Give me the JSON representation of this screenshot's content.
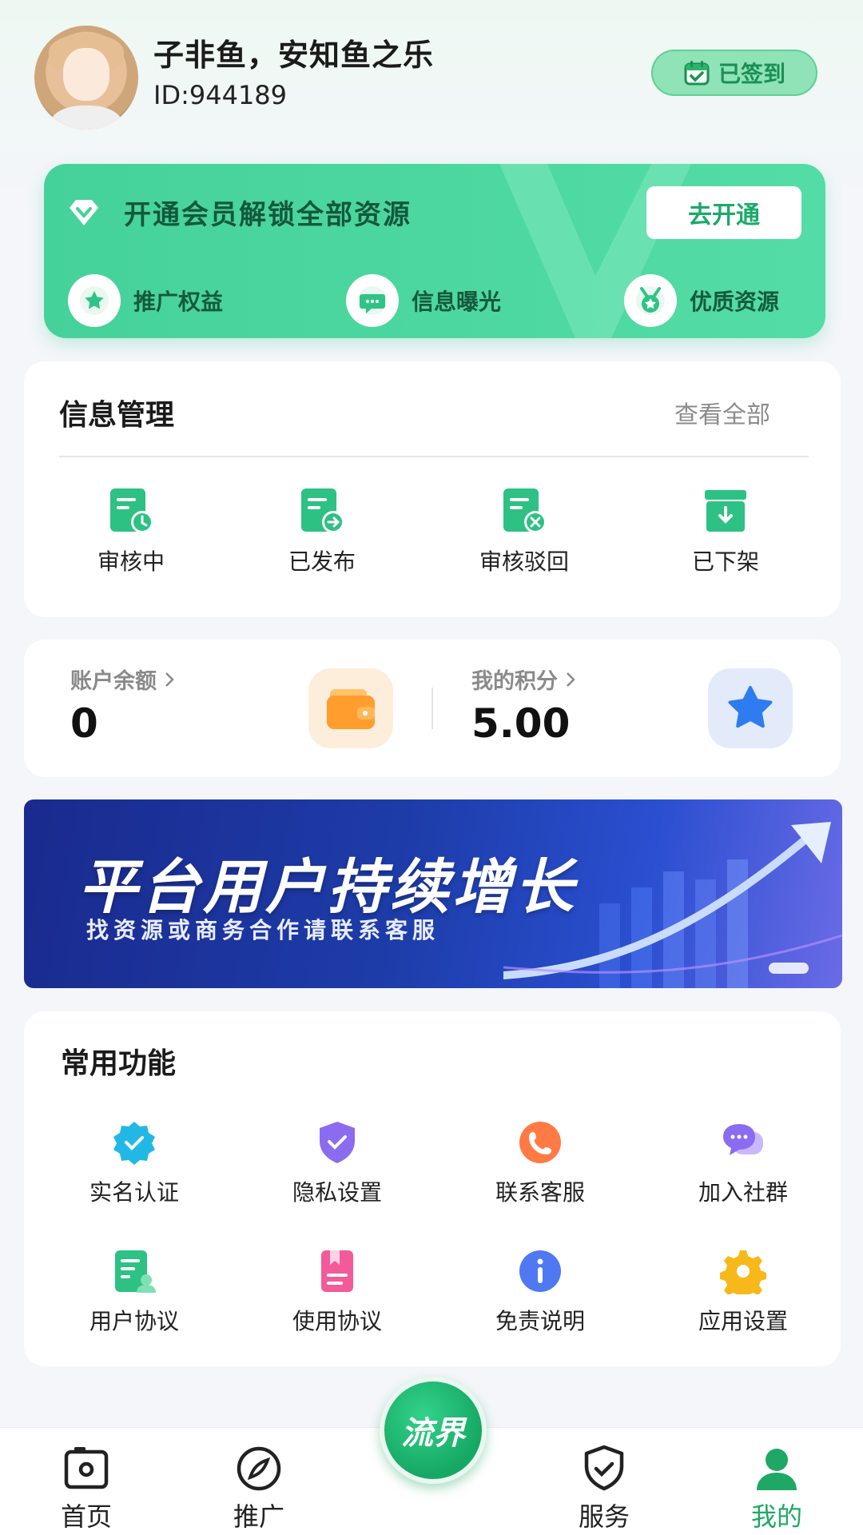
{
  "header": {
    "username": "子非鱼，安知鱼之乐",
    "user_id": "ID:944189",
    "signin_label": "已签到"
  },
  "vip": {
    "title": "开通会员解锁全部资源",
    "button": "去开通",
    "perks": [
      {
        "label": "推广权益",
        "icon": "star-icon"
      },
      {
        "label": "信息曝光",
        "icon": "chat-icon"
      },
      {
        "label": "优质资源",
        "icon": "medal-icon"
      }
    ]
  },
  "info_management": {
    "title": "信息管理",
    "view_all": "查看全部",
    "items": [
      {
        "label": "审核中",
        "icon": "clock-doc-icon"
      },
      {
        "label": "已发布",
        "icon": "arrow-doc-icon"
      },
      {
        "label": "审核驳回",
        "icon": "x-doc-icon"
      },
      {
        "label": "已下架",
        "icon": "archive-box-icon"
      }
    ]
  },
  "balance": {
    "account_label": "账户余额",
    "account_value": "0",
    "points_label": "我的积分",
    "points_value": "5.00"
  },
  "banner": {
    "title": "平台用户持续增长",
    "subtitle": "找资源或商务合作请联系客服"
  },
  "common_functions": {
    "title": "常用功能",
    "items": [
      {
        "label": "实名认证",
        "icon": "verified-badge-icon"
      },
      {
        "label": "隐私设置",
        "icon": "shield-check-icon"
      },
      {
        "label": "联系客服",
        "icon": "phone-icon"
      },
      {
        "label": "加入社群",
        "icon": "chat-bubbles-icon"
      },
      {
        "label": "用户协议",
        "icon": "user-doc-icon"
      },
      {
        "label": "使用协议",
        "icon": "bookmark-doc-icon"
      },
      {
        "label": "免责说明",
        "icon": "info-icon"
      },
      {
        "label": "应用设置",
        "icon": "gear-icon"
      }
    ]
  },
  "nav": {
    "items": [
      {
        "label": "首页",
        "icon": "camera-icon"
      },
      {
        "label": "推广",
        "icon": "compass-icon"
      },
      {
        "label": "服务",
        "icon": "shield-check-icon"
      },
      {
        "label": "我的",
        "icon": "person-icon"
      }
    ],
    "center_label": "流界",
    "active": "我的"
  },
  "colors": {
    "accent": "#1fa865",
    "vip_bg": "#4ed8a1",
    "banner_bg": "#1d3ca8"
  }
}
